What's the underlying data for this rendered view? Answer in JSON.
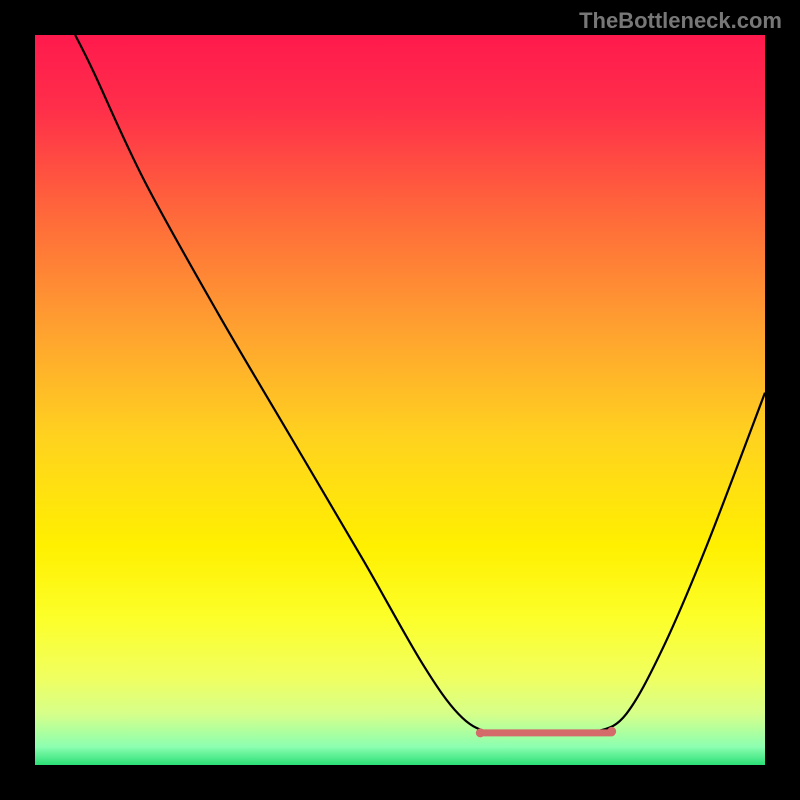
{
  "watermark": "TheBottleneck.com",
  "chart_data": {
    "type": "line",
    "title": "",
    "xlabel": "",
    "ylabel": "",
    "xlim": [
      0,
      100
    ],
    "ylim": [
      0,
      100
    ],
    "gradient_stops": [
      {
        "offset": 0.0,
        "color": "#ff1a4d"
      },
      {
        "offset": 0.1,
        "color": "#ff2e4a"
      },
      {
        "offset": 0.25,
        "color": "#ff6a3a"
      },
      {
        "offset": 0.4,
        "color": "#ffa030"
      },
      {
        "offset": 0.55,
        "color": "#ffd21f"
      },
      {
        "offset": 0.7,
        "color": "#fff000"
      },
      {
        "offset": 0.8,
        "color": "#fcff2a"
      },
      {
        "offset": 0.88,
        "color": "#f0ff60"
      },
      {
        "offset": 0.93,
        "color": "#d6ff8a"
      },
      {
        "offset": 0.975,
        "color": "#8cffb0"
      },
      {
        "offset": 1.0,
        "color": "#2bdf76"
      }
    ],
    "curve": [
      {
        "x": 5.5,
        "y": 100
      },
      {
        "x": 8,
        "y": 95
      },
      {
        "x": 15,
        "y": 80
      },
      {
        "x": 25,
        "y": 62
      },
      {
        "x": 35,
        "y": 45
      },
      {
        "x": 45,
        "y": 28
      },
      {
        "x": 53,
        "y": 14
      },
      {
        "x": 58,
        "y": 7
      },
      {
        "x": 62,
        "y": 4.5
      },
      {
        "x": 67,
        "y": 4.2
      },
      {
        "x": 72,
        "y": 4.3
      },
      {
        "x": 77,
        "y": 4.6
      },
      {
        "x": 81,
        "y": 7
      },
      {
        "x": 86,
        "y": 16
      },
      {
        "x": 92,
        "y": 30
      },
      {
        "x": 100,
        "y": 51
      }
    ],
    "flat_segment": {
      "x_start": 61,
      "x_end": 79,
      "y": 4.4,
      "color": "#d46a6a",
      "width": 7
    },
    "flat_markers": [
      {
        "x": 61,
        "y": 4.4,
        "r": 4.5,
        "color": "#d46a6a"
      },
      {
        "x": 79,
        "y": 4.6,
        "r": 4.5,
        "color": "#d46a6a"
      }
    ]
  }
}
